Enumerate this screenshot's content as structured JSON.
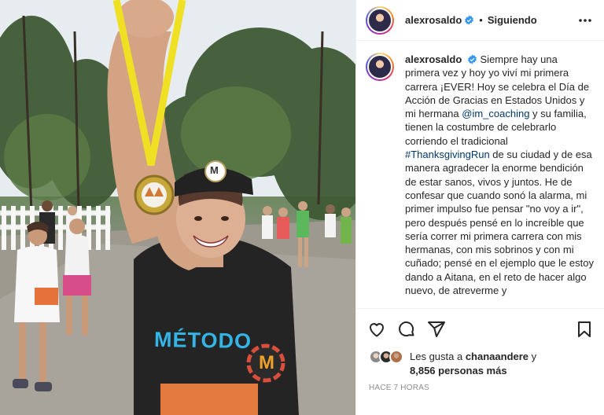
{
  "post": {
    "username": "alexrosaldo",
    "follow_status": "Siguiendo",
    "separator": "•",
    "caption": {
      "username": "alexrosaldo",
      "part1": "Siempre hay una primera vez y hoy yo viví mi primera carrera ¡EVER! Hoy se celebra el Día de Acción de Gracias en Estados Unidos y mi hermana ",
      "mention": "@im_coaching",
      "part2": " y su familia, tienen la costumbre de celebrarlo corriendo el tradicional ",
      "hashtag": "#ThanksgivingRun",
      "part3": " de su ciudad y de esa manera agradecer la enorme bendición de estar sanos, vivos y juntos. He de confesar que cuando sonó la alarma, mi primer impulso fue pensar \"no voy a ir\", pero después pensé en lo increíble que sería correr mi primera carrera con mis hermanas, con mis sobrinos y con mi cuñado; pensé en el ejemplo que le estoy dando a Aitana, en el reto de hacer algo nuevo, de atreverme y"
    },
    "likes": {
      "prefix": "Les gusta a ",
      "liked_by": "chanaandere",
      "middle": " y",
      "others": "8,856 personas más"
    },
    "timestamp": "HACE 7 HORAS"
  },
  "photo": {
    "shirt_text": "MÉTODO",
    "cap_logo": "M",
    "badge_letter": "M"
  },
  "icons": {
    "verified": "verified-badge-icon",
    "more": "more-horizontal-icon",
    "like": "heart-icon",
    "comment": "comment-icon",
    "share": "send-icon",
    "save": "bookmark-icon"
  },
  "colors": {
    "verified": "#3897f0",
    "link": "#00376b",
    "muted": "#8e8e8e",
    "text": "#262626"
  }
}
